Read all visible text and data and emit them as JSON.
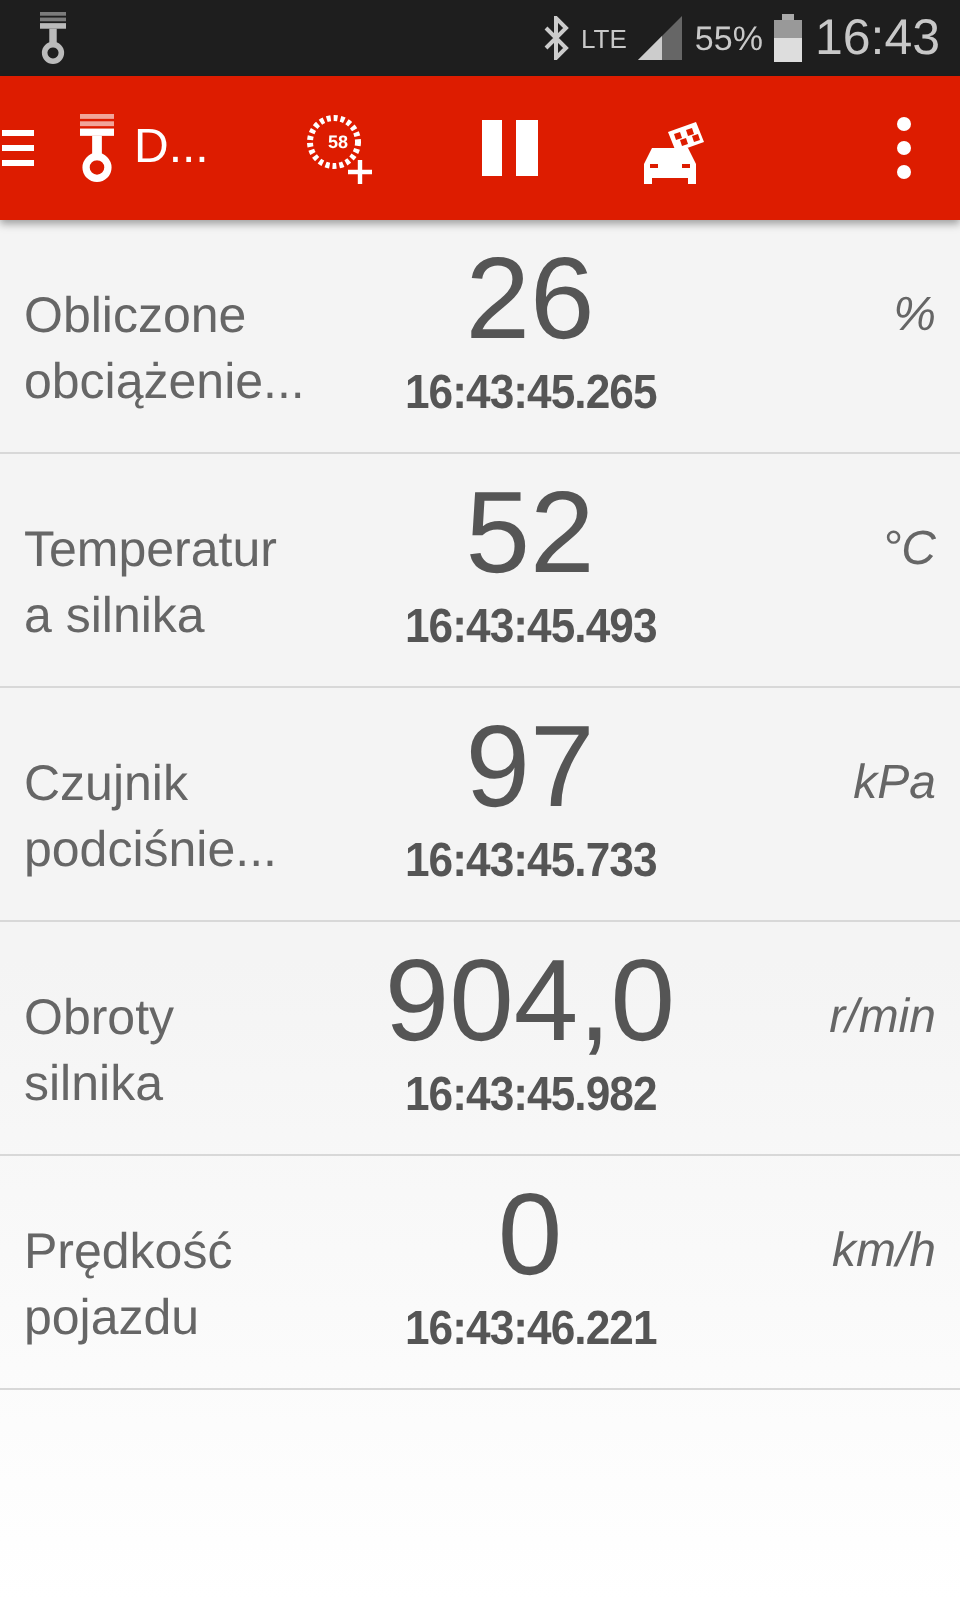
{
  "status_bar": {
    "network": "LTE",
    "battery": "55%",
    "time": "16:43"
  },
  "toolbar": {
    "title": "D...",
    "gauge_badge": "58"
  },
  "readings": [
    {
      "name_lines": [
        "Obliczone",
        "obciążenie..."
      ],
      "value": "26",
      "time": "16:43:45.265",
      "unit": "%"
    },
    {
      "name_lines": [
        "Temperatur",
        "a silnika"
      ],
      "value": "52",
      "time": "16:43:45.493",
      "unit": "°C"
    },
    {
      "name_lines": [
        "Czujnik",
        "podciśnie..."
      ],
      "value": "97",
      "time": "16:43:45.733",
      "unit": "kPa"
    },
    {
      "name_lines": [
        "Obroty",
        "silnika"
      ],
      "value": "904,0",
      "time": "16:43:45.982",
      "unit": "r/min"
    },
    {
      "name_lines": [
        "Prędkość",
        "pojazdu"
      ],
      "value": "0",
      "time": "16:43:46.221",
      "unit": "km/h"
    }
  ]
}
